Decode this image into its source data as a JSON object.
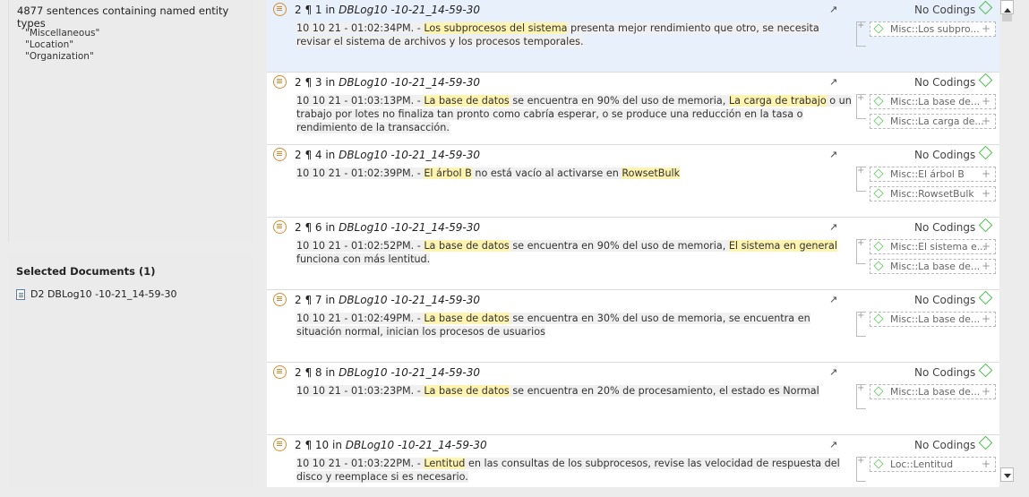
{
  "left": {
    "summary": "4877 sentences containing named entity types",
    "types": [
      "\"Miscellaneous\"",
      "\"Location\"",
      "\"Organization\""
    ],
    "selected_title": "Selected Documents (1)",
    "doc_label": "D2 DBLog10 -10-21_14-59-30"
  },
  "rows": [
    {
      "num": "2 ¶ 1 in",
      "doc": "DBLog10 -10-21_14-59-30",
      "status": "No Codings",
      "parts": [
        [
          "b",
          "10 10 21 - 01:02:34PM. - "
        ],
        [
          "hl",
          "Los subprocesos del sistema"
        ],
        [
          "b",
          " presenta mejor rendimiento que otro, se necesita revisar el sistema de archivos y los procesos temporales."
        ]
      ],
      "chips": [
        "Misc::Los subpro..."
      ]
    },
    {
      "num": "2 ¶ 3 in",
      "doc": "DBLog10 -10-21_14-59-30",
      "status": "No Codings",
      "parts": [
        [
          "b",
          "10 10 21 - 01:03:13PM. - "
        ],
        [
          "hl",
          "La base de datos"
        ],
        [
          "b",
          " se encuentra en 90% del uso de memoria, "
        ],
        [
          "hl",
          "La carga de trabajo"
        ],
        [
          "b",
          " o un trabajo por lotes no finaliza tan pronto como cabría esperar, o se produce una reducción en la tasa o rendimiento de la transacción."
        ]
      ],
      "chips": [
        "Misc::La base de...",
        "Misc::La carga de..."
      ]
    },
    {
      "num": "2 ¶ 4 in",
      "doc": "DBLog10 -10-21_14-59-30",
      "status": "No Codings",
      "parts": [
        [
          "b",
          "10 10 21 - 01:02:39PM. - "
        ],
        [
          "hl",
          "El árbol B"
        ],
        [
          "b",
          " no está vacío al activarse en "
        ],
        [
          "hl",
          "RowsetBulk"
        ]
      ],
      "chips": [
        "Misc::El árbol B",
        "Misc::RowsetBulk"
      ]
    },
    {
      "num": "2 ¶ 6 in",
      "doc": "DBLog10 -10-21_14-59-30",
      "status": "No Codings",
      "parts": [
        [
          "b",
          "10 10 21 - 01:02:52PM. - "
        ],
        [
          "hl",
          "La base de datos"
        ],
        [
          "b",
          " se encuentra en 90% del uso de memoria, "
        ],
        [
          "hl",
          "El sistema en general"
        ],
        [
          "b",
          " funciona con más lentitud."
        ]
      ],
      "chips": [
        "Misc::El sistema e...",
        "Misc::La base de..."
      ]
    },
    {
      "num": "2 ¶ 7 in",
      "doc": "DBLog10 -10-21_14-59-30",
      "status": "No Codings",
      "parts": [
        [
          "b",
          "10 10 21 - 01:02:49PM. - "
        ],
        [
          "hl",
          "La base de datos"
        ],
        [
          "b",
          " se encuentra en 30% del uso de memoria, se encuentra en situación normal, inician los procesos de usuarios"
        ]
      ],
      "chips": [
        "Misc::La base de..."
      ]
    },
    {
      "num": "2 ¶ 8 in",
      "doc": "DBLog10 -10-21_14-59-30",
      "status": "No Codings",
      "parts": [
        [
          "b",
          "10 10 21 - 01:03:23PM. - "
        ],
        [
          "hl",
          "La base de datos"
        ],
        [
          "b",
          " se encuentra en 20% de procesamiento, el estado  es Normal"
        ]
      ],
      "chips": [
        "Misc::La base de..."
      ]
    },
    {
      "num": "2 ¶ 10 in",
      "doc": "DBLog10 -10-21_14-59-30",
      "status": "No Codings",
      "parts": [
        [
          "b",
          "10 10 21 - 01:03:22PM. - "
        ],
        [
          "hl",
          "Lentitud"
        ],
        [
          "b",
          " en las consultas de los subprocesos, revise las velocidad de respuesta del disco y reemplace si es necesario."
        ]
      ],
      "chips": [
        "Loc::Lentitud"
      ]
    }
  ],
  "icons": {
    "quotation": "quotation-icon",
    "open": "open-arrow-icon",
    "code": "diamond-code-icon"
  }
}
